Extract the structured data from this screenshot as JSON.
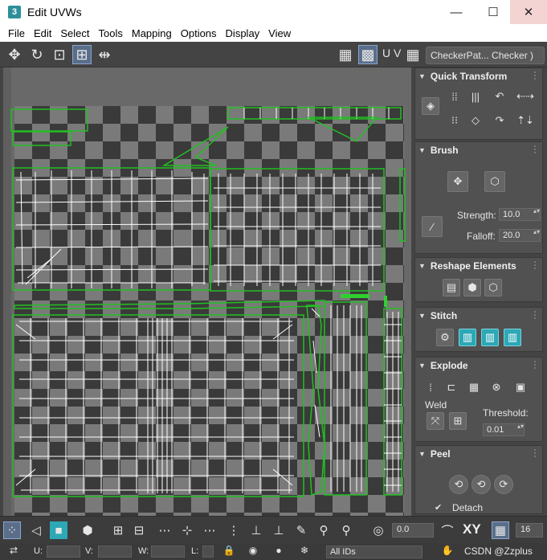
{
  "window": {
    "title": "Edit UVWs",
    "app_icon": "3",
    "controls": {
      "minimize": "—",
      "maximize": "☐",
      "close": "✕"
    }
  },
  "menu": [
    "File",
    "Edit",
    "Select",
    "Tools",
    "Mapping",
    "Options",
    "Display",
    "View"
  ],
  "toolbar": {
    "uv_label": "U V",
    "texture_select": "CheckerPat... Checker )"
  },
  "panel": {
    "quick_transform": {
      "title": "Quick Transform"
    },
    "brush": {
      "title": "Brush",
      "strength_label": "Strength:",
      "strength_value": "10.0",
      "falloff_label": "Falloff:",
      "falloff_value": "20.0"
    },
    "reshape": {
      "title": "Reshape Elements"
    },
    "stitch": {
      "title": "Stitch"
    },
    "explode": {
      "title": "Explode",
      "weld_label": "Weld",
      "threshold_label": "Threshold:",
      "threshold_value": "0.01"
    },
    "peel": {
      "title": "Peel",
      "detach_label": "Detach"
    }
  },
  "bottombar": {
    "angle_value": "0.0",
    "xy_label": "XY",
    "grid_value": "16"
  },
  "statusbar": {
    "u_label": "U:",
    "v_label": "V:",
    "w_label": "W:",
    "l_label": "L:",
    "ids_select": "All IDs",
    "watermark": "CSDN @Zzplus"
  },
  "colors": {
    "accent_blue": "#5a6e8a",
    "teal": "#2da8b6",
    "uv_green": "#1fc21f",
    "uv_white": "#ffffff"
  }
}
